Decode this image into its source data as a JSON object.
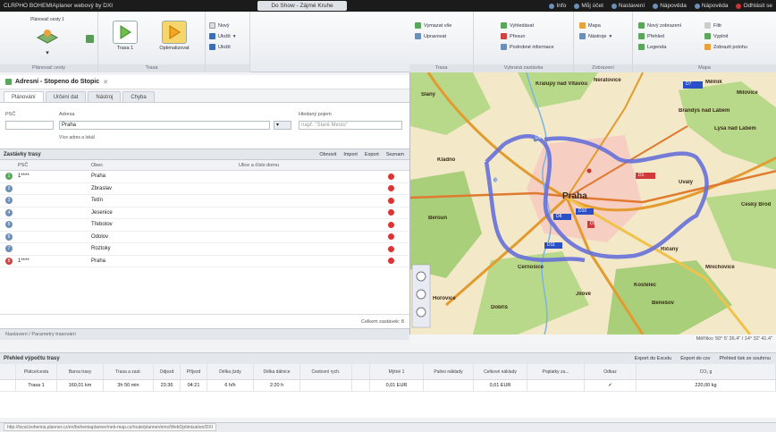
{
  "topbar": {
    "title": "CLRPHO BOHEMIAplaner webový by DXI",
    "center_button": "Do Show - Zájmé Kruhe",
    "links": [
      {
        "icon": "info-icon",
        "label": "Info"
      },
      {
        "icon": "user-icon",
        "label": "Můj účet"
      },
      {
        "icon": "gear-icon",
        "label": "Nastavení"
      },
      {
        "icon": "help-icon",
        "label": "Nápověda"
      },
      {
        "icon": "help-icon",
        "label": "Nápověda"
      },
      {
        "icon": "logout-icon",
        "label": "Odhlásit se"
      }
    ]
  },
  "ribbon_left": {
    "groups": [
      {
        "label": "Plánovač cesty",
        "button": "Plánovač cesty 1"
      },
      {
        "label": "Trasa",
        "buttons": [
          "Trasa 1",
          "Optimalizovat"
        ]
      },
      {
        "label": "",
        "items": [
          "Nový",
          "Uložit",
          "Uložit"
        ]
      }
    ]
  },
  "ribbon_right": {
    "groups": [
      {
        "label": "Trasa",
        "items": [
          "Vymazat vše",
          "Upravovat"
        ]
      },
      {
        "label": "Vybraná zastávka",
        "items": [
          "Vyhledávat",
          "Přesun",
          "Podrobné informace"
        ]
      },
      {
        "label": "Zobrazení",
        "items": [
          "Mapa",
          "Nástroje"
        ]
      },
      {
        "label": "Mapa",
        "items": [
          "Nový zobrazení",
          "Přehled",
          "Legenda",
          "Filtr",
          "Vyplnit",
          "Zobrazit polohu"
        ]
      }
    ]
  },
  "panel": {
    "title": "Adresní - Stopeno do Stopic",
    "tabs": [
      "Plánování",
      "Určení dat",
      "Nástroj",
      "Chyba"
    ],
    "form": {
      "psc_label": "PSČ",
      "address_label": "Adresa",
      "address_value": "Praha",
      "search_label": "Hledaný pojem",
      "search_placeholder": "např. \"Staré Mesto\"",
      "hint": "Více adres a lokál"
    }
  },
  "stops": {
    "title": "Zastávky trasy",
    "tools": [
      "Obnovit",
      "Import",
      "Export",
      "Seznam"
    ],
    "columns": [
      "PSČ",
      "Obec",
      "Ulice a číslo domu"
    ],
    "rows": [
      {
        "num": "1",
        "psc": "1****",
        "obec": "Praha",
        "ulice": "",
        "color": "green"
      },
      {
        "num": "2",
        "psc": "",
        "obec": "Zbraslav",
        "ulice": "",
        "color": "blue"
      },
      {
        "num": "3",
        "psc": "",
        "obec": "Tetín",
        "ulice": "",
        "color": "blue"
      },
      {
        "num": "4",
        "psc": "",
        "obec": "Jesenice",
        "ulice": "",
        "color": "blue"
      },
      {
        "num": "5",
        "psc": "",
        "obec": "Třebotov",
        "ulice": "",
        "color": "blue"
      },
      {
        "num": "6",
        "psc": "",
        "obec": "Odolov",
        "ulice": "",
        "color": "blue"
      },
      {
        "num": "7",
        "psc": "",
        "obec": "Roztoky",
        "ulice": "",
        "color": "blue"
      },
      {
        "num": "8",
        "psc": "1****",
        "obec": "Praha",
        "ulice": "",
        "color": "red"
      }
    ],
    "summary": "Celkem zastávek: 8",
    "collapsed_section": "Nastavení / Parametry trasování"
  },
  "map": {
    "towns": [
      "Slaný",
      "Kralupy nad Vltavou",
      "Neratovice",
      "Mělník",
      "Brandýs nad Labem",
      "Lysá nad Labem",
      "Praha",
      "Beroun",
      "Kladno",
      "Říčany",
      "Černošice",
      "Jílové",
      "Benešov",
      "Český Brod",
      "Úvaly",
      "Mnichovice",
      "Dobříš",
      "Hořovice",
      "Kostelec",
      "Milovice"
    ],
    "route_labels": [
      "D7",
      "D8",
      "D10",
      "D11",
      "D1",
      "D5",
      "D0",
      "D0"
    ],
    "statusline": "Měřítko: 50° 5' 36.4\" / 14° 32' 41.4\""
  },
  "bottom": {
    "title": "Přehled výpočtu trasy",
    "tools": [
      "Export do Excelu",
      "Export do csv",
      "Přehled tisk ze souhrnu"
    ],
    "columns": [
      "",
      "Plátce/cesta",
      "Barva trasy",
      "Trasa a zast.",
      "Odjezd",
      "Příjezd",
      "Délka jízdy",
      "Délka dálnice",
      "Cestovní rych.",
      "",
      "Mýtné 1",
      "Palivo náklady",
      "Celkové náklady",
      "Poplatky za...",
      "Odkaz",
      "CO₂ g"
    ],
    "row": [
      "",
      "Trasa 1",
      "160,01 km",
      "3h 50 min",
      "23:36",
      "04:21",
      "6 h/h",
      "2:20 h",
      "",
      "",
      "0,01 EUR",
      "",
      "0,01 EUR",
      "",
      "✔",
      "220,00 kg"
    ]
  },
  "statusbar": {
    "url": "http://local.bohemia.planner.cz/en/bohemiaplanner/neb-map.cz/route/planner/ems/WebOptimization/DXI"
  }
}
